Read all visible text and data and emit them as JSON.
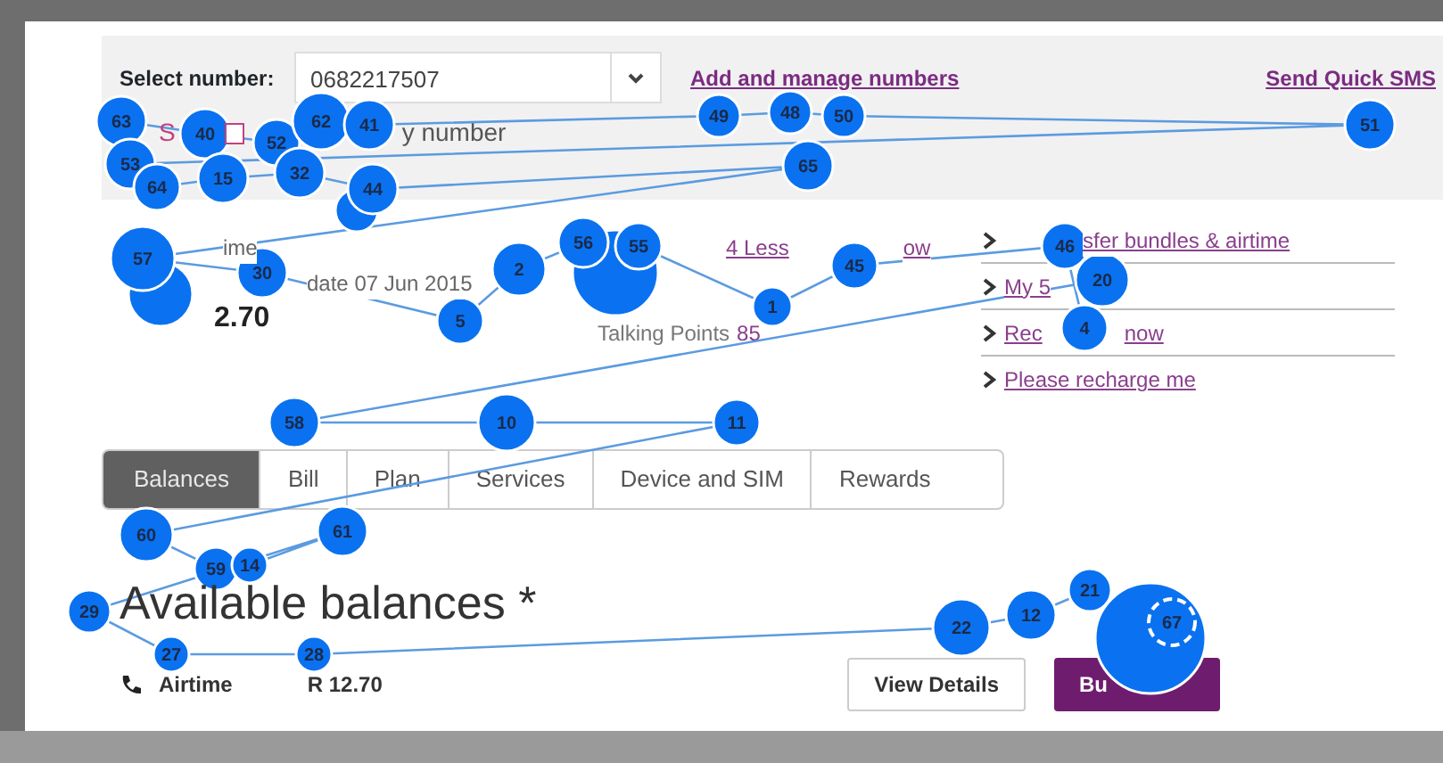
{
  "header": {
    "select_label": "Select number:",
    "select_value": "0682217507",
    "manage_link": "Add and manage numbers",
    "sms_link": "Send Quick SMS",
    "row2_link": "S",
    "row2_checked": false,
    "row2_text": "y number"
  },
  "summary": {
    "left": [
      {
        "text": "ime",
        "kind": "plain"
      },
      {
        "text": "date 07 Jun 2015",
        "kind": "plain"
      },
      {
        "text": "2.70",
        "kind": "amount"
      }
    ],
    "middle": {
      "offer": "4 Less",
      "offer_tail": "ow",
      "points_label": "Talking Points",
      "points_value": "85"
    },
    "links": [
      {
        "text": "sfer bundles & airtime"
      },
      {
        "text": "My 5"
      },
      {
        "text": "Rec",
        "tail": "now"
      },
      {
        "text": "Please recharge me"
      }
    ]
  },
  "tabs": [
    {
      "label": "Balances",
      "selected": true
    },
    {
      "label": "Bill",
      "selected": false
    },
    {
      "label": "Plan",
      "selected": false
    },
    {
      "label": "Services",
      "selected": false
    },
    {
      "label": "Device and SIM",
      "selected": false
    },
    {
      "label": "Rewards",
      "selected": false
    }
  ],
  "balances": {
    "title": "Available balances *",
    "item": "Airtime",
    "amount": "R 12.70",
    "buttons": [
      {
        "label": "View Details",
        "kind": "outline"
      },
      {
        "label": "Bu",
        "kind": "primary"
      }
    ]
  },
  "gaze_plot": {
    "fixations": [
      {
        "label": "63",
        "selected": false
      },
      {
        "label": "40",
        "selected": false
      },
      {
        "label": "52",
        "selected": false
      },
      {
        "label": "62",
        "selected": false
      },
      {
        "label": "41",
        "selected": false
      },
      {
        "label": "49",
        "selected": false
      },
      {
        "label": "48",
        "selected": false
      },
      {
        "label": "50",
        "selected": false
      },
      {
        "label": "51",
        "selected": false
      },
      {
        "label": "53",
        "selected": false
      },
      {
        "label": "64",
        "selected": false
      },
      {
        "label": "15",
        "selected": false
      },
      {
        "label": "32",
        "selected": false
      },
      {
        "label": "44",
        "selected": false
      },
      {
        "label": "65",
        "selected": false
      },
      {
        "label": "57",
        "selected": false
      },
      {
        "label": "30",
        "selected": false
      },
      {
        "label": "5",
        "selected": false
      },
      {
        "label": "2",
        "selected": false
      },
      {
        "label": "56",
        "selected": false
      },
      {
        "label": "55",
        "selected": false
      },
      {
        "label": "1",
        "selected": false
      },
      {
        "label": "45",
        "selected": false
      },
      {
        "label": "46",
        "selected": false
      },
      {
        "label": "4",
        "selected": false
      },
      {
        "label": "20",
        "selected": false
      },
      {
        "label": "58",
        "selected": false
      },
      {
        "label": "10",
        "selected": false
      },
      {
        "label": "11",
        "selected": false
      },
      {
        "label": "60",
        "selected": false
      },
      {
        "label": "59",
        "selected": false
      },
      {
        "label": "14",
        "selected": false
      },
      {
        "label": "61",
        "selected": false
      },
      {
        "label": "29",
        "selected": false
      },
      {
        "label": "27",
        "selected": false
      },
      {
        "label": "28",
        "selected": false
      },
      {
        "label": "22",
        "selected": false
      },
      {
        "label": "12",
        "selected": false
      },
      {
        "label": "21",
        "selected": false
      },
      {
        "label": "67",
        "selected": true
      }
    ]
  }
}
